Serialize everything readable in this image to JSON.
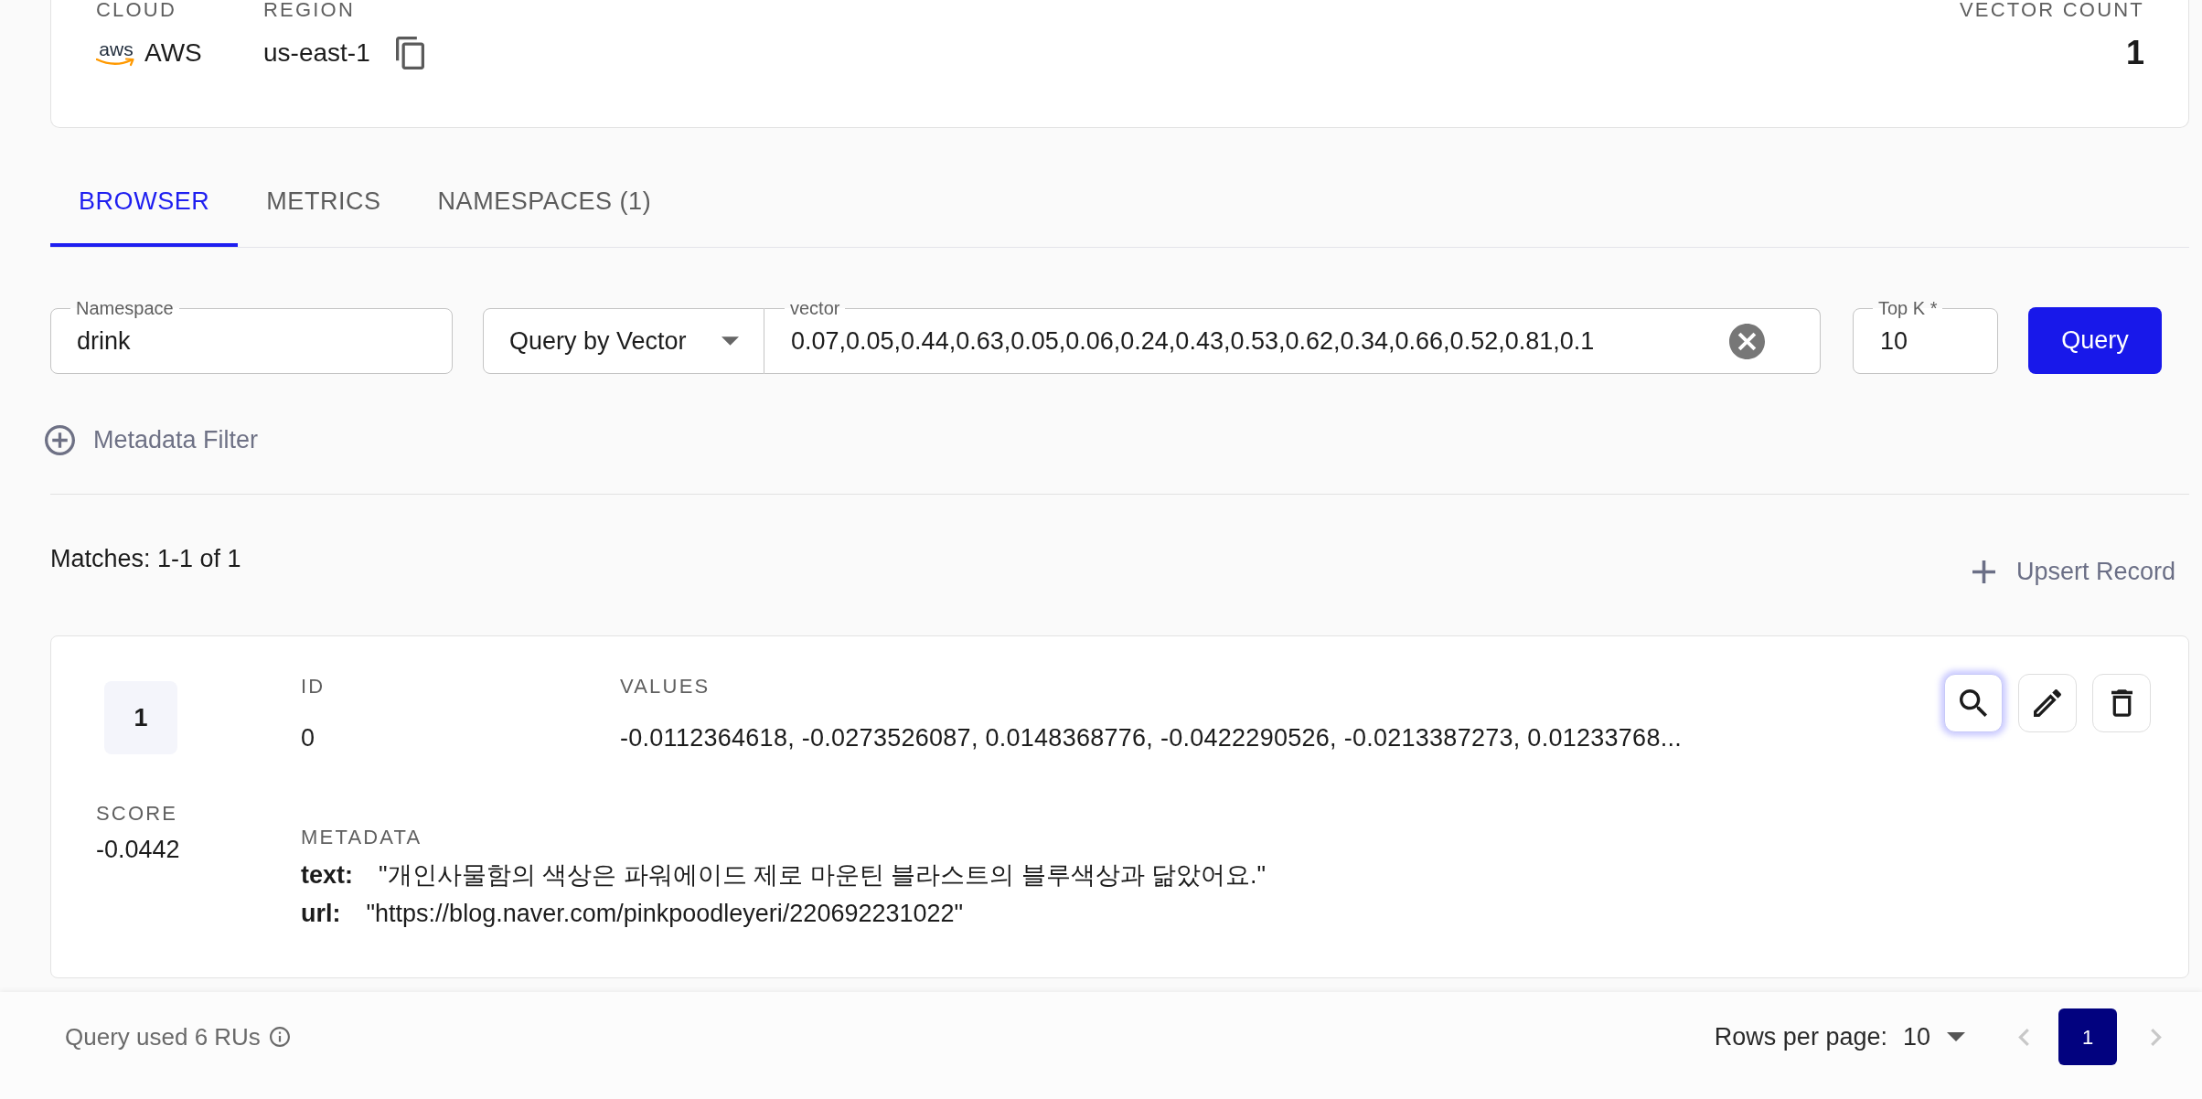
{
  "summary": {
    "cloud": {
      "label": "CLOUD",
      "logo_text": "aws",
      "value": "AWS"
    },
    "region": {
      "label": "REGION",
      "value": "us-east-1"
    },
    "vector_count": {
      "label": "VECTOR COUNT",
      "value": "1"
    }
  },
  "tabs": [
    {
      "label": "BROWSER",
      "selected": true
    },
    {
      "label": "METRICS",
      "selected": false
    },
    {
      "label": "NAMESPACES (1)",
      "selected": false
    }
  ],
  "query_form": {
    "namespace": {
      "label": "Namespace",
      "value": "drink"
    },
    "query_mode": {
      "value": "Query by Vector"
    },
    "vector": {
      "label": "vector",
      "value": "0.07,0.05,0.44,0.63,0.05,0.06,0.24,0.43,0.53,0.62,0.34,0.66,0.52,0.81,0.1"
    },
    "top_k": {
      "label": "Top K *",
      "value": "10"
    },
    "submit_button": "Query"
  },
  "metadata_filter": {
    "label": "Metadata Filter"
  },
  "results": {
    "summary": "Matches: 1-1 of 1",
    "upsert_button": "Upsert Record",
    "matches": [
      {
        "rank": "1",
        "id_label": "ID",
        "id": "0",
        "values_label": "VALUES",
        "values": "-0.0112364618, -0.0273526087, 0.0148368776, -0.0422290526, -0.0213387273, 0.01233768...",
        "score_label": "SCORE",
        "score": "-0.0442",
        "metadata_label": "METADATA",
        "metadata": [
          {
            "key": "text:",
            "value": "\"개인사물함의 색상은 파워에이드 제로 마운틴 블라스트의 블루색상과 닮았어요.\""
          },
          {
            "key": "url:",
            "value": "\"https://blog.naver.com/pinkpoodleyeri/220692231022\""
          }
        ],
        "actions": [
          {
            "kind": "search",
            "focused": true
          },
          {
            "kind": "edit",
            "focused": false
          },
          {
            "kind": "delete",
            "focused": false
          }
        ]
      }
    ]
  },
  "footer": {
    "usage": "Query used 6 RUs",
    "rows_per_page_label": "Rows per page:",
    "rows_per_page": "10",
    "prev": {
      "disabled": true
    },
    "pages": [
      {
        "label": "1",
        "selected": true
      }
    ],
    "next": {
      "disabled": true
    }
  }
}
